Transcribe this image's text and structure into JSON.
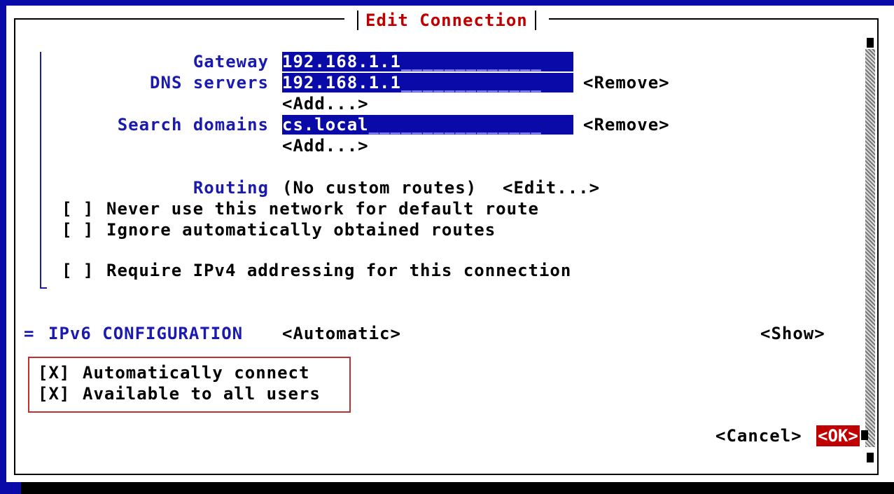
{
  "dialog": {
    "title": "Edit Connection"
  },
  "ipv4": {
    "gateway": {
      "label": "Gateway",
      "value": "192.168.1.1",
      "fill": "_____________"
    },
    "dns": {
      "label": "DNS servers",
      "value": "192.168.1.1",
      "fill": "_____________",
      "remove_label": "<Remove>",
      "add_label": "<Add...>"
    },
    "search": {
      "label": "Search domains",
      "value": "cs.local",
      "fill": "________________",
      "remove_label": "<Remove>",
      "add_label": "<Add...>"
    },
    "routing": {
      "label": "Routing",
      "value": "(No custom routes)",
      "edit_label": "<Edit...>"
    },
    "never_default": {
      "box": "[ ]",
      "label": "Never use this network for default route",
      "checked": false
    },
    "ignore_auto": {
      "box": "[ ]",
      "label": "Ignore automatically obtained routes",
      "checked": false
    },
    "require_ipv4": {
      "box": "[ ]",
      "label": "Require IPv4 addressing for this connection",
      "checked": false
    }
  },
  "ipv6": {
    "marker": "=",
    "label": "IPv6 CONFIGURATION",
    "mode": "<Automatic>",
    "show_label": "<Show>"
  },
  "options": {
    "auto_connect": {
      "box": "[X]",
      "label": "Automatically connect",
      "checked": true
    },
    "all_users": {
      "box": "[X]",
      "label": "Available to all users",
      "checked": true
    }
  },
  "buttons": {
    "cancel": "<Cancel>",
    "ok": "<OK>"
  },
  "colors": {
    "background_blue": "#0a0aa8",
    "label_blue": "#1a1ab0",
    "title_red": "#c00000",
    "highlight_border": "#c03030"
  }
}
